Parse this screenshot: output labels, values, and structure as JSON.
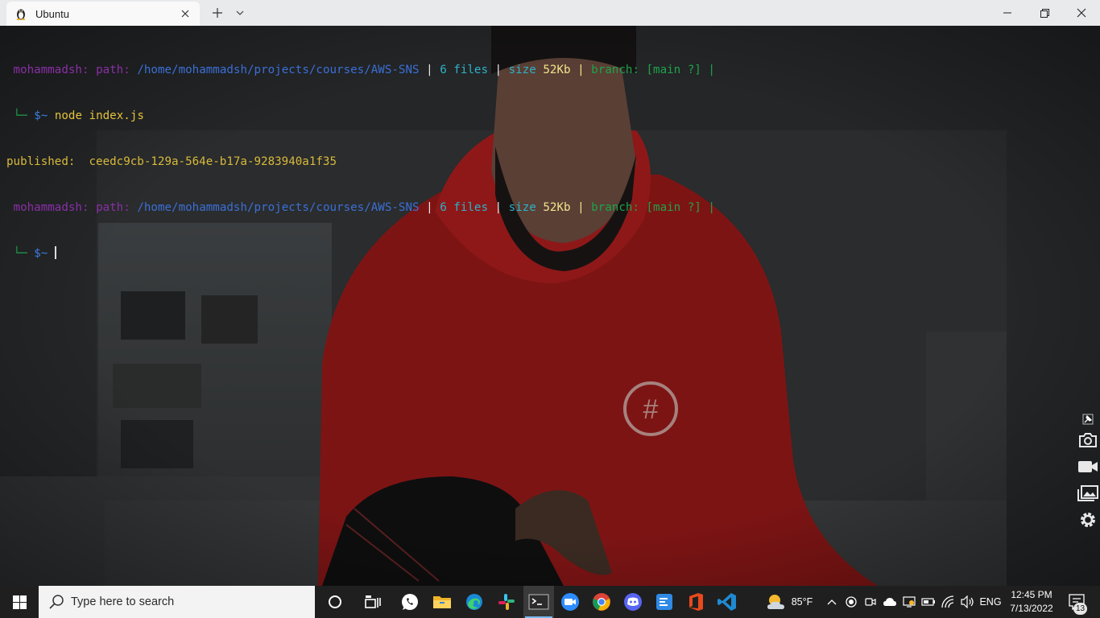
{
  "window": {
    "tab_title": "Ubuntu"
  },
  "terminal": {
    "line1": {
      "user": "mohammadsh:",
      "path_label": "path:",
      "path": "/home/mohammadsh/projects/courses/AWS-SNS",
      "sep1": "|",
      "files_count": "6",
      "files_label": "files",
      "sep2": "|",
      "size_label": "size",
      "size_value": "52Kb",
      "sep3": "|",
      "branch_label": "branch:",
      "branch_value": "[main ?]",
      "sep4": "|"
    },
    "prompt_corner": "└─",
    "prompt_symbol": "$~",
    "command": "node index.js",
    "output_label": "published:",
    "output_value": "ceedc9cb-129a-564e-b17a-9283940a1f35"
  },
  "taskbar": {
    "search_placeholder": "Type here to search",
    "weather_temp": "85°F",
    "language": "ENG",
    "time": "12:45 PM",
    "date": "7/13/2022",
    "notification_count": "13"
  },
  "colors": {
    "user": "#8a2fa6",
    "path": "#3c6fd6",
    "cyan": "#2fb2c9",
    "yellow": "#f1e38c",
    "green": "#1ea34a",
    "output": "#d8b93c",
    "hoodie": "#b81e1e"
  },
  "icons": {
    "tab": "linux-penguin-icon",
    "side_panel": [
      "pin-icon",
      "camera-icon",
      "video-icon",
      "gallery-icon",
      "settings-icon"
    ],
    "taskbar_apps": [
      "cortana-icon",
      "task-view-icon",
      "whatsapp-icon",
      "file-explorer-icon",
      "edge-icon",
      "slack-icon",
      "terminal-icon",
      "zoom-icon",
      "chrome-icon",
      "discord-icon",
      "todo-icon",
      "office-icon",
      "vscode-icon"
    ]
  }
}
